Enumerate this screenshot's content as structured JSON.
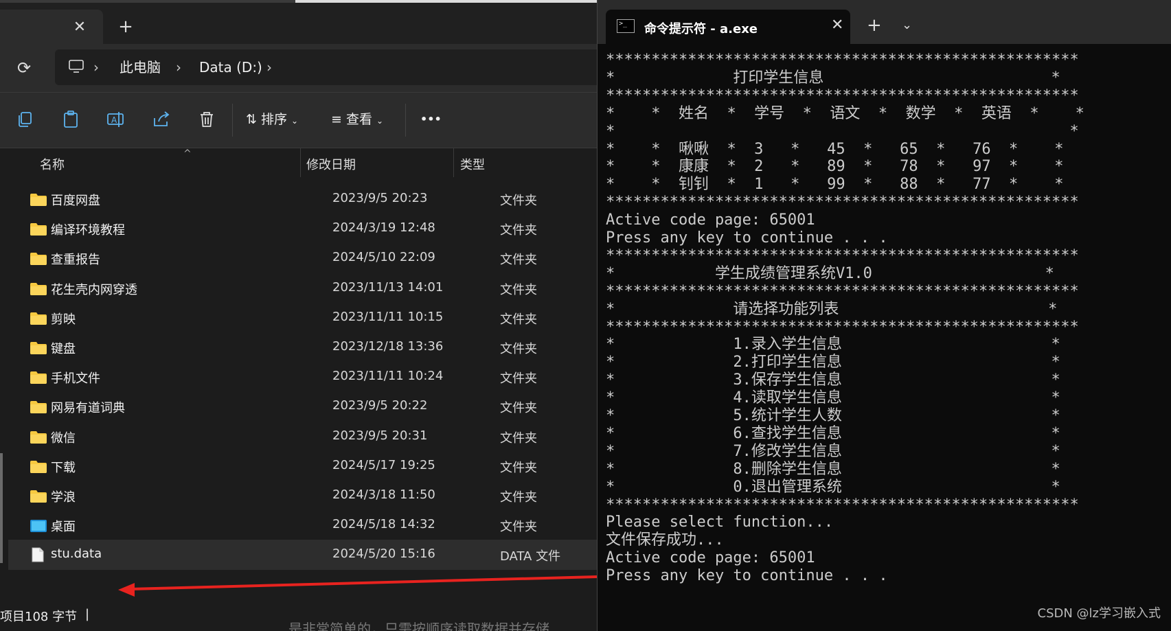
{
  "explorer": {
    "tab_close": "✕",
    "tab_add": "+",
    "breadcrumbs": [
      "此电脑",
      "Data (D:)"
    ],
    "toolbar": {
      "sort_label": "排序",
      "view_label": "查看",
      "more_label": "•••"
    },
    "columns": {
      "name": "名称",
      "date": "修改日期",
      "type": "类型"
    },
    "rows": [
      {
        "name": "百度网盘",
        "date": "2023/9/5 20:23",
        "type": "文件夹",
        "kind": "folder"
      },
      {
        "name": "编译环境教程",
        "date": "2024/3/19 12:48",
        "type": "文件夹",
        "kind": "folder"
      },
      {
        "name": "查重报告",
        "date": "2024/5/10 22:09",
        "type": "文件夹",
        "kind": "folder"
      },
      {
        "name": "花生壳内网穿透",
        "date": "2023/11/13 14:01",
        "type": "文件夹",
        "kind": "folder"
      },
      {
        "name": "剪映",
        "date": "2023/11/11 10:15",
        "type": "文件夹",
        "kind": "folder"
      },
      {
        "name": "键盘",
        "date": "2023/12/18 13:36",
        "type": "文件夹",
        "kind": "folder"
      },
      {
        "name": "手机文件",
        "date": "2023/11/11 10:24",
        "type": "文件夹",
        "kind": "folder"
      },
      {
        "name": "网易有道词典",
        "date": "2023/9/5 20:22",
        "type": "文件夹",
        "kind": "folder"
      },
      {
        "name": "微信",
        "date": "2023/9/5 20:31",
        "type": "文件夹",
        "kind": "folder"
      },
      {
        "name": "下载",
        "date": "2024/5/17 19:25",
        "type": "文件夹",
        "kind": "folder"
      },
      {
        "name": "学浪",
        "date": "2024/3/18 11:50",
        "type": "文件夹",
        "kind": "folder"
      },
      {
        "name": "桌面",
        "date": "2024/5/18 14:32",
        "type": "文件夹",
        "kind": "desktop"
      },
      {
        "name": "stu.data",
        "date": "2024/5/20 15:16",
        "type": "DATA 文件",
        "kind": "file"
      }
    ],
    "status": {
      "left": "项目",
      "size": "108 字节",
      "cursor": "|"
    },
    "under_text": "是非常简单的，只需按顺序读取数据并存储"
  },
  "console": {
    "title": "命令提示符 - a.exe",
    "close": "✕",
    "add": "+",
    "dropdown": "⌄",
    "lines": [
      "****************************************************",
      "*             打印学生信息                         *",
      "****************************************************",
      "*    *  姓名  *  学号  *  语文  *  数学  *  英语  *    *",
      "*                                                  *",
      "*    *  啾啾  *  3   *   45  *   65  *   76  *    *",
      "*    *  康康  *  2   *   89  *   78  *   97  *    *",
      "*    *  钊钊  *  1   *   99  *   88  *   77  *    *",
      "****************************************************",
      "Active code page: 65001",
      "Press any key to continue . . .",
      "****************************************************",
      "*           学生成绩管理系统V1.0                   *",
      "****************************************************",
      "*             请选择功能列表                       *",
      "****************************************************",
      "*             1.录入学生信息                       *",
      "*             2.打印学生信息                       *",
      "*             3.保存学生信息                       *",
      "*             4.读取学生信息                       *",
      "*             5.统计学生人数                       *",
      "*             6.查找学生信息                       *",
      "*             7.修改学生信息                       *",
      "*             8.删除学生信息                       *",
      "*             0.退出管理系统                       *",
      "****************************************************",
      "Please select function...",
      "文件保存成功...",
      "Active code page: 65001",
      "Press any key to continue . . ."
    ],
    "watermark": "CSDN @lz学习嵌入式"
  },
  "colors": {
    "folder": "#f7c940",
    "arrow": "#e8231f",
    "console_text": "#cccccc"
  }
}
